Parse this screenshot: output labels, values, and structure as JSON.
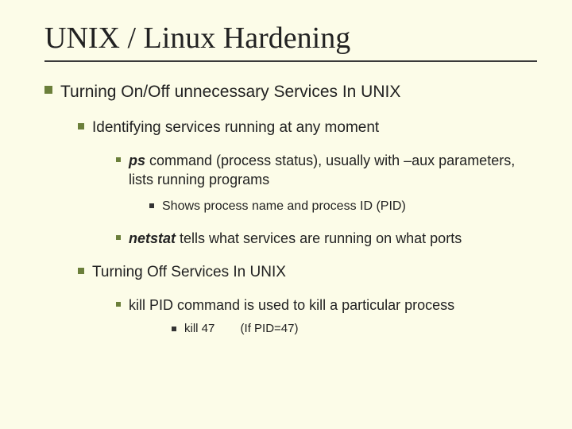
{
  "title": "UNIX / Linux Hardening",
  "l0_text": "Turning On/Off unnecessary Services In UNIX",
  "l1a_text": "Identifying services running at any moment",
  "l2a_cmd": "ps",
  "l2a_rest": " command (process status), usually with –aux parameters, lists running programs",
  "l3a_text": "Shows process name and process ID (PID)",
  "l2b_cmd": "netstat",
  "l2b_rest": " tells what services are running on what ports",
  "l1b_text": "Turning Off Services In UNIX",
  "l2c_text": "kill PID command is used to kill a particular process",
  "l4a_text": "kill 47",
  "l4a_note": "(If PID=47)"
}
